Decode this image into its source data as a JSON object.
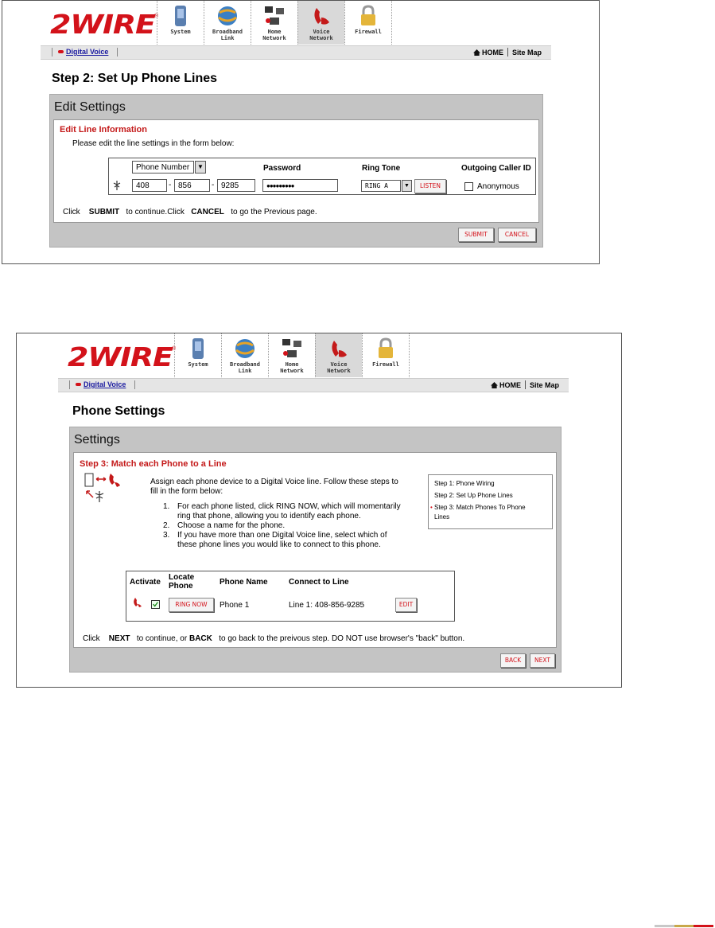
{
  "brand": {
    "logo": "2WIRE",
    "reg": "®",
    "colors": {
      "brand_red": "#d3121a",
      "tab_active": "#d9d9d9",
      "panel_gray": "#c4c4c4"
    }
  },
  "nav": {
    "tabs": [
      {
        "label_lines": [
          "System"
        ],
        "icon": "system-icon"
      },
      {
        "label_lines": [
          "Broadband",
          "Link"
        ],
        "icon": "globe-icon"
      },
      {
        "label_lines": [
          "Home",
          "Network"
        ],
        "icon": "network-icon"
      },
      {
        "label_lines": [
          "Voice",
          "Network"
        ],
        "icon": "phone-icon",
        "active": true
      },
      {
        "label_lines": [
          "Firewall"
        ],
        "icon": "lock-icon"
      }
    ]
  },
  "subnav": {
    "digital_voice": "Digital Voice",
    "home": "HOME",
    "sitemap": "Site Map"
  },
  "screen1": {
    "page_title": "Step 2: Set Up Phone Lines",
    "panel_title": "Edit Settings",
    "section_title": "Edit Line Information",
    "instruction": "Please edit the line settings in the form below:",
    "phone_type": "Phone Number",
    "phone_parts": [
      "408",
      "856",
      "9285"
    ],
    "dash": "-",
    "password_label": "Password",
    "password_value": "●●●●●●●●●",
    "ringtone_label": "Ring Tone",
    "ringtone_value": "RING A",
    "listen": "LISTEN",
    "callerid_label": "Outgoing Caller ID",
    "anonymous": "Anonymous",
    "footer": {
      "click1": "Click",
      "submit_word": "SUBMIT",
      "mid": "to continue.Click",
      "cancel_word": "CANCEL",
      "tail": "to go the Previous page."
    },
    "buttons": {
      "submit": "SUBMIT",
      "cancel": "CANCEL"
    }
  },
  "screen2": {
    "page_title": "Phone Settings",
    "panel_title": "Settings",
    "section_title": "Step 3: Match each Phone to a Line",
    "intro_line1": "Assign each phone device to a Digital Voice line. Follow these steps to",
    "intro_line2": "fill in the form below:",
    "steps": [
      {
        "n": "1.",
        "lines": [
          "For each phone listed, click RING NOW, which will momentarily",
          "ring that phone, allowing you to identify each phone."
        ]
      },
      {
        "n": "2.",
        "lines": [
          "Choose a name for the phone."
        ]
      },
      {
        "n": "3.",
        "lines": [
          "If you have more than one Digital Voice line, select which of",
          "these phone lines you would like to connect to this phone."
        ]
      }
    ],
    "side_steps": [
      "Step 1: Phone Wiring",
      "Step 2: Set Up Phone Lines",
      "Step 3: Match Phones To Phone",
      "Lines"
    ],
    "table": {
      "headers": {
        "activate": "Activate",
        "locate1": "Locate",
        "locate2": "Phone",
        "name": "Phone Name",
        "line": "Connect to Line"
      },
      "row": {
        "ring_now": "RING NOW",
        "phone_name": "Phone 1",
        "line": "Line 1: 408-856-9285",
        "edit": "EDIT"
      }
    },
    "footer": {
      "click": "Click",
      "next_word": "NEXT",
      "mid": "to continue, or",
      "back_word": "BACK",
      "tail": "to go back to the preivous step. DO NOT use browser's \"back\" button."
    },
    "buttons": {
      "back": "BACK",
      "next": "NEXT"
    }
  }
}
